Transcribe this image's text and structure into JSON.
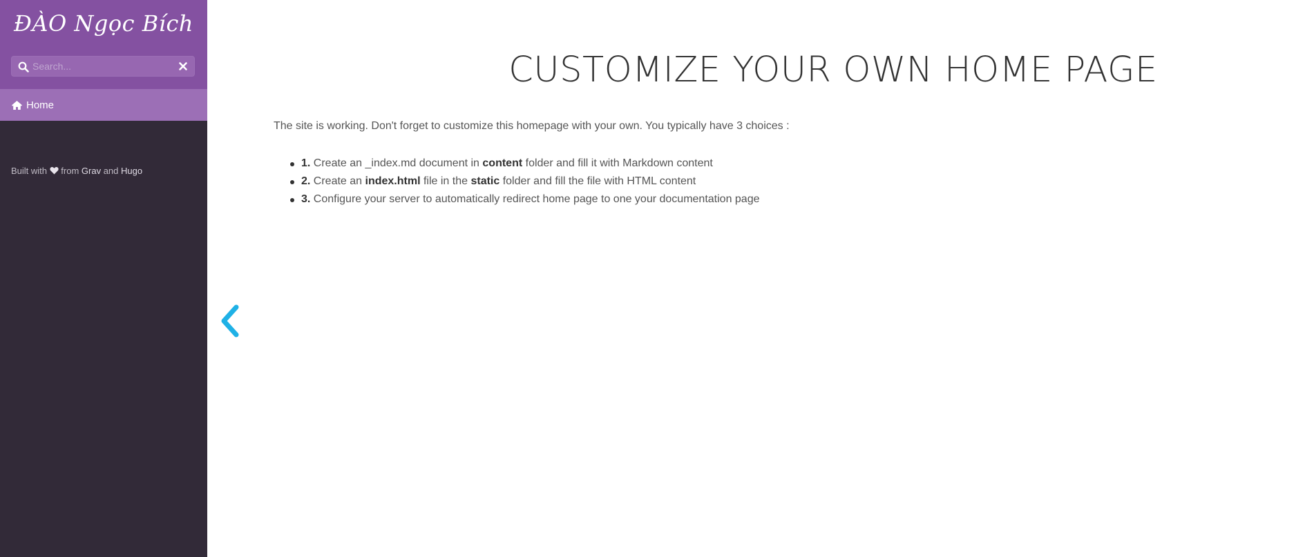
{
  "sidebar": {
    "logo_text": "ĐÀO Ngọc Bích",
    "search": {
      "placeholder": "Search...",
      "value": "",
      "icon": "search-icon",
      "clear_icon": "close-icon"
    },
    "nav_items": [
      {
        "label": "Home",
        "icon": "home-icon",
        "active": true
      }
    ],
    "footer": {
      "prefix": "Built with",
      "heart_icon": "heart-icon",
      "middle": "from",
      "link1": "Grav",
      "conjunction": "and",
      "link2": "Hugo"
    },
    "colors": {
      "header_bg": "#8451a1",
      "body_bg": "#322a38",
      "active_item_bg": "#9c6fb6"
    }
  },
  "main": {
    "title": "CUSTOMIZE YOUR OWN HOME PAGE",
    "intro": "The site is working. Don't forget to customize this homepage with your own. You typically have 3 choices :",
    "choices": [
      {
        "num": "1.",
        "t1": "Create an _index.md document in ",
        "b1": "content",
        "t2": " folder and fill it with Markdown content",
        "b2": "",
        "t3": ""
      },
      {
        "num": "2.",
        "t1": "Create an ",
        "b1": "index.html",
        "t2": " file in the ",
        "b2": "static",
        "t3": " folder and fill the file with HTML content"
      },
      {
        "num": "3.",
        "t1": "Configure your server to automatically redirect home page to one your documentation page",
        "b1": "",
        "t2": "",
        "b2": "",
        "t3": ""
      }
    ],
    "prev_arrow_icon": "chevron-left-icon",
    "accent_color": "#1fb1e6"
  }
}
